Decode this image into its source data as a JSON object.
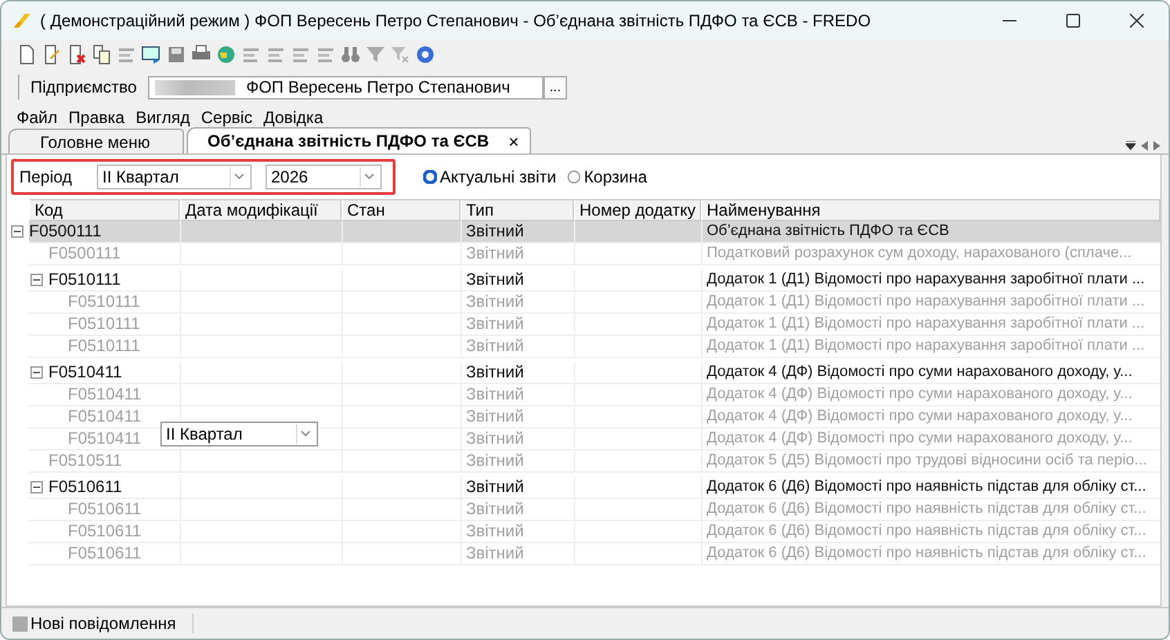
{
  "window": {
    "title": "( Демонстраційний режим ) ФОП Вересень Петро Степанович - Об’єднана звітність ПДФО та ЄСВ - FREDO"
  },
  "enterprise": {
    "label": "Підприємство",
    "value": "ФОП Вересень Петро Степанович",
    "browse": "..."
  },
  "menu": [
    "Файл",
    "Правка",
    "Вигляд",
    "Сервіс",
    "Довідка"
  ],
  "tabs": [
    {
      "label": "Головне меню",
      "selected": false
    },
    {
      "label": "Об’єднана звітність ПДФО та ЄСВ",
      "selected": true,
      "close": "×"
    }
  ],
  "filter": {
    "label": "Період",
    "period": "II Квартал",
    "year": "2026",
    "modes": [
      {
        "label": "Актуальні звіти",
        "selected": true
      },
      {
        "label": "Корзина",
        "selected": false
      }
    ]
  },
  "table": {
    "columns": [
      "Код",
      "Дата модифікації",
      "Стан",
      "Тип",
      "Номер додатку",
      "Найменування"
    ],
    "rows": [
      {
        "code": "F0500111",
        "type": "Звітний",
        "name": "Об’єднана звітність ПДФО та ЄСВ",
        "dimmed": false,
        "selected": true,
        "expanded": true,
        "children": [
          {
            "code": "F0500111",
            "type": "Звітний",
            "name": "Податковий розрахунок сум доходу, нарахованого (сплаче...",
            "dimmed": true,
            "selected": false
          },
          {
            "code": "F0510111",
            "type": "Звітний",
            "name": "Додаток 1 (Д1) Відомості про нарахування заробітної плати ...",
            "dimmed": false,
            "selected": false,
            "expanded": true,
            "children": [
              {
                "code": "F0510111",
                "type": "Звітний",
                "name": "Додаток 1 (Д1) Відомості про нарахування заробітної плати ...",
                "dimmed": true,
                "selected": false
              },
              {
                "code": "F0510111",
                "type": "Звітний",
                "name": "Додаток 1 (Д1) Відомості про нарахування заробітної плати ...",
                "dimmed": true,
                "selected": false
              },
              {
                "code": "F0510111",
                "type": "Звітний",
                "name": "Додаток 1 (Д1) Відомості про нарахування заробітної плати ...",
                "dimmed": true,
                "selected": false
              }
            ]
          },
          {
            "code": "F0510411",
            "type": "Звітний",
            "name": "Додаток 4 (ДФ) Відомості про суми нарахованого доходу, у...",
            "dimmed": false,
            "selected": false,
            "expanded": true,
            "children": [
              {
                "code": "F0510411",
                "type": "Звітний",
                "name": "Додаток 4 (ДФ) Відомості про суми нарахованого доходу, у...",
                "dimmed": true,
                "selected": false
              },
              {
                "code": "F0510411",
                "type": "Звітний",
                "name": "Додаток 4 (ДФ) Відомості про суми нарахованого доходу, у...",
                "dimmed": true,
                "selected": false
              },
              {
                "code": "F0510411",
                "type": "Звітний",
                "name": "Додаток 4 (ДФ) Відомості про суми нарахованого доходу, у...",
                "dimmed": true,
                "selected": false
              }
            ]
          },
          {
            "code": "F0510511",
            "type": "Звітний",
            "name": "Додаток 5 (Д5) Відомості про трудові відносини осіб та періо...",
            "dimmed": true,
            "selected": false
          },
          {
            "code": "F0510611",
            "type": "Звітний",
            "name": "Додаток 6 (Д6) Відомості про наявність підстав для обліку ст...",
            "dimmed": false,
            "selected": false,
            "expanded": true,
            "children": [
              {
                "code": "F0510611",
                "type": "Звітний",
                "name": "Додаток 6 (Д6) Відомості про наявність підстав для обліку ст...",
                "dimmed": true,
                "selected": false
              },
              {
                "code": "F0510611",
                "type": "Звітний",
                "name": "Додаток 6 (Д6) Відомості про наявність підстав для обліку ст...",
                "dimmed": true,
                "selected": false
              },
              {
                "code": "F0510611",
                "type": "Звітний",
                "name": "Додаток 6 (Д6) Відомості про наявність підстав для обліку ст...",
                "dimmed": true,
                "selected": false
              }
            ]
          }
        ]
      }
    ]
  },
  "floating_combo": {
    "value": "II Квартал"
  },
  "status_bar": {
    "message": "Нові повідомлення"
  }
}
